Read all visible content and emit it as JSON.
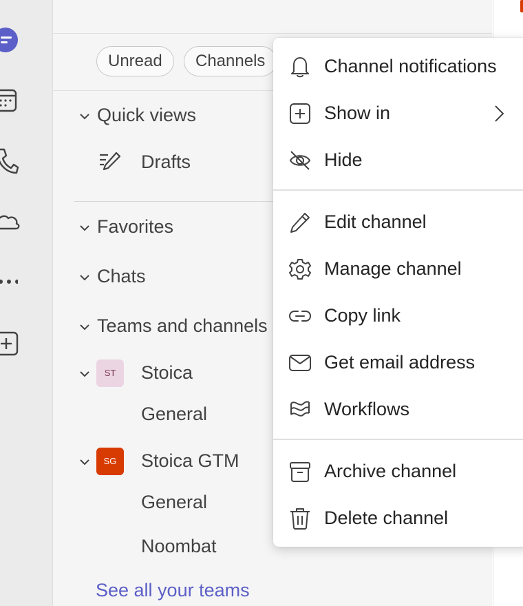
{
  "rail": {
    "icons": [
      "chat-icon",
      "calendar-icon",
      "calls-icon",
      "onedrive-icon",
      "more-apps-icon",
      "add-apps-icon"
    ]
  },
  "filters": {
    "unread": "Unread",
    "channels": "Channels"
  },
  "sections": {
    "quick_views": "Quick views",
    "drafts": "Drafts",
    "favorites": "Favorites",
    "chats": "Chats",
    "teams_and_channels": "Teams and channels"
  },
  "teams": [
    {
      "avatar_text": "ST",
      "avatar_color": "#ecd5e2",
      "avatar_text_color": "#7a3b58",
      "name": "Stoica",
      "channels": [
        "General"
      ]
    },
    {
      "avatar_text": "SG",
      "avatar_color": "#d83b01",
      "avatar_text_color": "#ffffff",
      "name": "Stoica GTM",
      "channels": [
        "General",
        "Noombat"
      ]
    }
  ],
  "see_all_teams": "See all your teams",
  "accent_color": "#5b5fc7",
  "context_menu": {
    "items": [
      {
        "label": "Channel notifications",
        "icon": "bell-icon"
      },
      {
        "label": "Show in",
        "icon": "add-square-icon",
        "submenu": true
      },
      {
        "label": "Hide",
        "icon": "eye-off-icon"
      },
      {
        "label": "Edit channel",
        "icon": "pencil-icon"
      },
      {
        "label": "Manage channel",
        "icon": "gear-icon"
      },
      {
        "label": "Copy link",
        "icon": "link-icon"
      },
      {
        "label": "Get email address",
        "icon": "mail-icon"
      },
      {
        "label": "Workflows",
        "icon": "workflows-icon"
      },
      {
        "label": "Archive channel",
        "icon": "archive-icon"
      },
      {
        "label": "Delete channel",
        "icon": "trash-icon"
      }
    ]
  }
}
